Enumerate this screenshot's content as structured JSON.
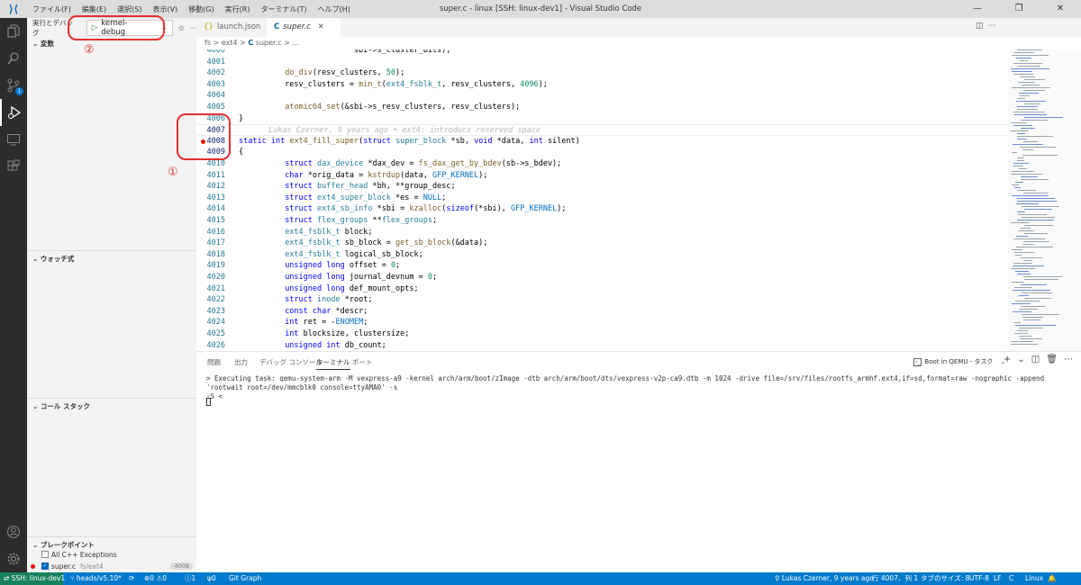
{
  "titlebar": {
    "menu": [
      "ファイル(F)",
      "編集(E)",
      "選択(S)",
      "表示(V)",
      "移動(G)",
      "実行(R)",
      "ターミナル(T)",
      "ヘルプ(H)"
    ],
    "title": "super.c - linux [SSH: linux-dev1] - Visual Studio Code"
  },
  "sidebar": {
    "header": "実行とデバッグ",
    "config": "kernel-debug",
    "sections": {
      "variables": "変数",
      "watch": "ウォッチ式",
      "callstack": "コール スタック",
      "breakpoints": "ブレークポイント"
    },
    "bp_items": [
      {
        "label": "All C++ Exceptions"
      },
      {
        "label": "super.c",
        "path": "fs/ext4",
        "line": "4008"
      }
    ],
    "scm_badge": "1"
  },
  "tabs": [
    {
      "label": "launch.json",
      "icon": "{}"
    },
    {
      "label": "super.c",
      "icon": "C"
    }
  ],
  "breadcrumb": [
    "fs",
    "ext4",
    "super.c",
    "..."
  ],
  "code_lines": [
    {
      "n": "4000",
      "t": "                         sbi->s_cluster_bits);"
    },
    {
      "n": "4001",
      "t": ""
    },
    {
      "n": "4002",
      "t": "          do_div(resv_clusters, 50);"
    },
    {
      "n": "4003",
      "t": "          resv_clusters = min_t(ext4_fsblk_t, resv_clusters, 4096);"
    },
    {
      "n": "4004",
      "t": ""
    },
    {
      "n": "4005",
      "t": "          atomic64_set(&sbi->s_resv_clusters, resv_clusters);"
    },
    {
      "n": "4006",
      "t": "}"
    },
    {
      "n": "4007",
      "t": ""
    },
    {
      "n": "4008",
      "t": "static int ext4_fill_super(struct super_block *sb, void *data, int silent)"
    },
    {
      "n": "4009",
      "t": "{"
    },
    {
      "n": "4010",
      "t": "          struct dax_device *dax_dev = fs_dax_get_by_bdev(sb->s_bdev);"
    },
    {
      "n": "4011",
      "t": "          char *orig_data = kstrdup(data, GFP_KERNEL);"
    },
    {
      "n": "4012",
      "t": "          struct buffer_head *bh, **group_desc;"
    },
    {
      "n": "4013",
      "t": "          struct ext4_super_block *es = NULL;"
    },
    {
      "n": "4014",
      "t": "          struct ext4_sb_info *sbi = kzalloc(sizeof(*sbi), GFP_KERNEL);"
    },
    {
      "n": "4015",
      "t": "          struct flex_groups **flex_groups;"
    },
    {
      "n": "4016",
      "t": "          ext4_fsblk_t block;"
    },
    {
      "n": "4017",
      "t": "          ext4_fsblk_t sb_block = get_sb_block(&data);"
    },
    {
      "n": "4018",
      "t": "          ext4_fsblk_t logical_sb_block;"
    },
    {
      "n": "4019",
      "t": "          unsigned long offset = 0;"
    },
    {
      "n": "4020",
      "t": "          unsigned long journal_devnum = 0;"
    },
    {
      "n": "4021",
      "t": "          unsigned long def_mount_opts;"
    },
    {
      "n": "4022",
      "t": "          struct inode *root;"
    },
    {
      "n": "4023",
      "t": "          const char *descr;"
    },
    {
      "n": "4024",
      "t": "          int ret = -ENOMEM;"
    },
    {
      "n": "4025",
      "t": "          int blocksize, clustersize;"
    },
    {
      "n": "4026",
      "t": "          unsigned int db_count;"
    }
  ],
  "blame": "Lukas Czerner, 9 years ago • ext4: introduce reserved space",
  "panel": {
    "tabs": [
      "問題",
      "出力",
      "デバッグ コンソール",
      "ターミナル",
      "ポート"
    ],
    "terminal_select": "Boot in QEMU - タスク",
    "terminal_text": "> Executing task: qemu-system-arm -M vexpress-a9 -kernel arch/arm/boot/zImage -dtb arch/arm/boot/dts/vexpress-v2p-ca9.dtb -m 1024 -drive file=/srv/files/rootfs_armhf.ext4,if=sd,format=raw -nographic -append 'rootwait root=/dev/mmcblk0 console=ttyAMA0' -s\n-S <"
  },
  "statusbar": {
    "remote": "SSH: linux-dev1",
    "branch": "heads/v5.10*",
    "errors": "0",
    "warnings": "0",
    "info": "1",
    "ports": "0",
    "gitgraph": "Git Graph",
    "blame": "Lukas Czerner, 9 years ago",
    "position": "行 4007、列 1",
    "tab": "タブのサイズ: 8",
    "encoding": "UTF-8",
    "eol": "LF",
    "lang": "C",
    "os": "Linux"
  },
  "annotations": {
    "one": "①",
    "two": "②"
  }
}
